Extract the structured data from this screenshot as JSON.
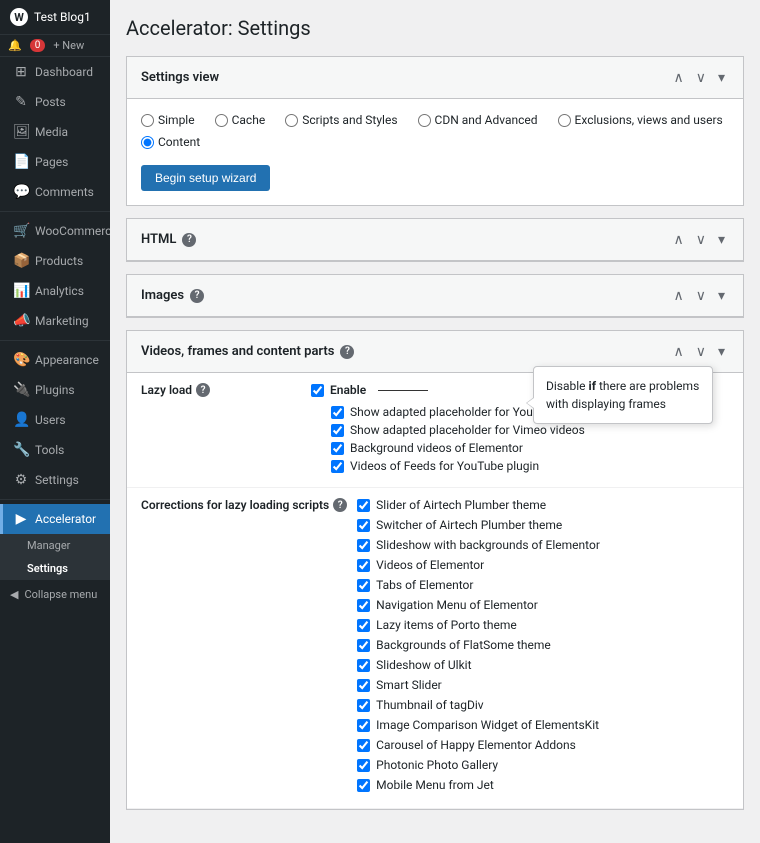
{
  "site": {
    "name": "Test Blog1",
    "wp_icon": "W"
  },
  "topbar": {
    "notifications": "0",
    "new_label": "+ New"
  },
  "sidebar": {
    "items": [
      {
        "id": "dashboard",
        "label": "Dashboard",
        "icon": "⊞"
      },
      {
        "id": "posts",
        "label": "Posts",
        "icon": "✎"
      },
      {
        "id": "media",
        "label": "Media",
        "icon": "⬛"
      },
      {
        "id": "pages",
        "label": "Pages",
        "icon": "📄"
      },
      {
        "id": "comments",
        "label": "Comments",
        "icon": "💬"
      },
      {
        "id": "woocommerce",
        "label": "WooCommerce",
        "icon": "🛒"
      },
      {
        "id": "products",
        "label": "Products",
        "icon": "📦"
      },
      {
        "id": "analytics",
        "label": "Analytics",
        "icon": "📊"
      },
      {
        "id": "marketing",
        "label": "Marketing",
        "icon": "📣"
      },
      {
        "id": "appearance",
        "label": "Appearance",
        "icon": "🎨"
      },
      {
        "id": "plugins",
        "label": "Plugins",
        "icon": "🔌"
      },
      {
        "id": "users",
        "label": "Users",
        "icon": "👤"
      },
      {
        "id": "tools",
        "label": "Tools",
        "icon": "🔧"
      },
      {
        "id": "settings",
        "label": "Settings",
        "icon": "⚙"
      },
      {
        "id": "accelerator",
        "label": "Accelerator",
        "icon": "▶"
      }
    ],
    "submenu": {
      "parent": "Accelerator",
      "items": [
        {
          "id": "manager",
          "label": "Manager"
        },
        {
          "id": "settings",
          "label": "Settings",
          "active": true
        }
      ]
    },
    "collapse_label": "Collapse menu"
  },
  "page": {
    "title": "Accelerator: Settings"
  },
  "settings_view": {
    "header": "Settings view",
    "options": [
      {
        "id": "simple",
        "label": "Simple",
        "checked": true
      },
      {
        "id": "cache",
        "label": "Cache",
        "checked": false
      },
      {
        "id": "scripts_styles",
        "label": "Scripts and Styles",
        "checked": false
      },
      {
        "id": "cdn_advanced",
        "label": "CDN and Advanced",
        "checked": false
      },
      {
        "id": "exclusions",
        "label": "Exclusions, views and users",
        "checked": false
      },
      {
        "id": "content",
        "label": "Content",
        "checked": true
      }
    ],
    "wizard_btn": "Begin setup wizard"
  },
  "html_section": {
    "title": "HTML"
  },
  "images_section": {
    "title": "Images"
  },
  "videos_section": {
    "title": "Videos, frames and content parts",
    "tooltip": {
      "text_part1": "Disable ",
      "text_bold": "if",
      "text_part2": " there are problems with displaying frames"
    }
  },
  "lazy_load": {
    "label": "Lazy load",
    "enable_label": "Enable",
    "checks": [
      {
        "id": "youtube",
        "label": "Show adapted placeholder for YouTube videos",
        "checked": true
      },
      {
        "id": "vimeo",
        "label": "Show adapted placeholder for Vimeo videos",
        "checked": true
      },
      {
        "id": "elementor_bg",
        "label": "Background videos of Elementor",
        "checked": true
      },
      {
        "id": "youtube_feeds",
        "label": "Videos of Feeds for YouTube plugin",
        "checked": true
      }
    ]
  },
  "corrections": {
    "label": "Corrections for lazy loading scripts",
    "checks": [
      {
        "id": "airtech_slider",
        "label": "Slider of Airtech Plumber theme",
        "checked": true
      },
      {
        "id": "airtech_switcher",
        "label": "Switcher of Airtech Plumber theme",
        "checked": true
      },
      {
        "id": "elementor_slideshow",
        "label": "Slideshow with backgrounds of Elementor",
        "checked": true
      },
      {
        "id": "elementor_videos",
        "label": "Videos of Elementor",
        "checked": true
      },
      {
        "id": "elementor_tabs",
        "label": "Tabs of Elementor",
        "checked": true
      },
      {
        "id": "elementor_nav",
        "label": "Navigation Menu of Elementor",
        "checked": true
      },
      {
        "id": "porto_lazy",
        "label": "Lazy items of Porto theme",
        "checked": true
      },
      {
        "id": "flatsome_bg",
        "label": "Backgrounds of FlatSome theme",
        "checked": true
      },
      {
        "id": "ulkit_slideshow",
        "label": "Slideshow of Ulkit",
        "checked": true
      },
      {
        "id": "smart_slider",
        "label": "Smart Slider",
        "checked": true
      },
      {
        "id": "tagdiv_thumb",
        "label": "Thumbnail of tagDiv",
        "checked": true
      },
      {
        "id": "elementskit_img",
        "label": "Image Comparison Widget of ElementsKit",
        "checked": true
      },
      {
        "id": "happy_carousel",
        "label": "Carousel of Happy Elementor Addons",
        "checked": true
      },
      {
        "id": "photonic_gallery",
        "label": "Photonic Photo Gallery",
        "checked": true
      },
      {
        "id": "jet_mobile",
        "label": "Mobile Menu from Jet",
        "checked": true
      }
    ]
  }
}
